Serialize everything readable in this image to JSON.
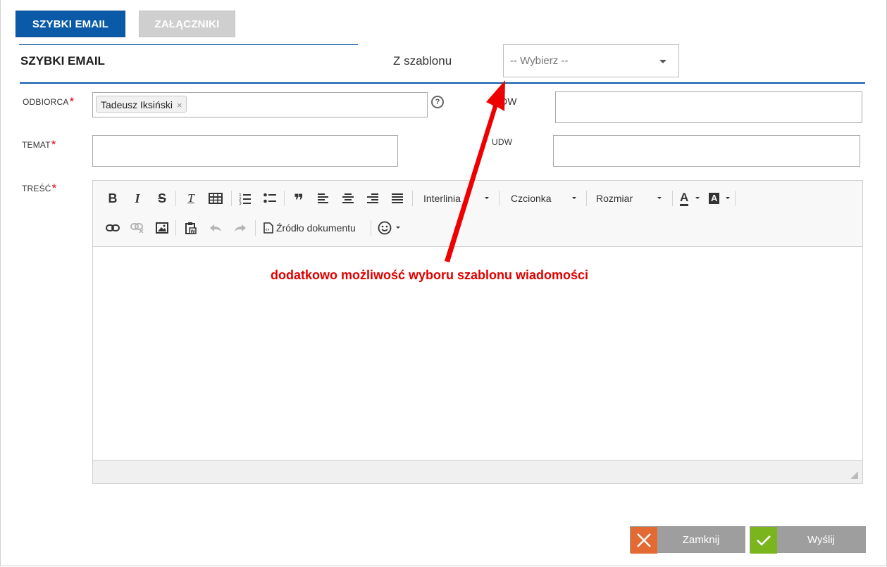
{
  "tabs": [
    {
      "label": "SZYBKI EMAIL",
      "active": true
    },
    {
      "label": "ZAŁĄCZNIKI",
      "active": false
    }
  ],
  "section_title": "SZYBKI EMAIL",
  "template": {
    "label": "Z szablonu",
    "selected": "-- Wybierz --"
  },
  "fields": {
    "recipient": {
      "label": "ODBIORCA",
      "required_mark": "*",
      "tags": [
        "Tadeusz Iksiński"
      ],
      "remove_glyph": "×"
    },
    "cc": {
      "label": "DW",
      "value": ""
    },
    "subject": {
      "label": "TEMAT",
      "required_mark": "*",
      "value": ""
    },
    "bcc": {
      "label": "UDW",
      "value": ""
    },
    "body": {
      "label": "TREŚĆ",
      "required_mark": "*"
    }
  },
  "editor": {
    "buttons_row1": {
      "bold": "B",
      "italic": "I",
      "strike": "S",
      "remove_format": "T",
      "quote": "❞"
    },
    "dropdowns": {
      "line_height": "Interlinia",
      "font": "Czcionka",
      "size": "Rozmiar"
    },
    "text_color": "A",
    "bg_color": "A",
    "source_label": "Źródło dokumentu"
  },
  "annotation": "dodatkowo możliwość wyboru szablonu wiadomości",
  "buttons": {
    "close": "Zamknij",
    "send": "Wyślij"
  },
  "colors": {
    "primary": "#0a5aa8",
    "annotation": "#e10000",
    "close_accent": "#e46a33",
    "send_accent": "#7ab51d"
  }
}
